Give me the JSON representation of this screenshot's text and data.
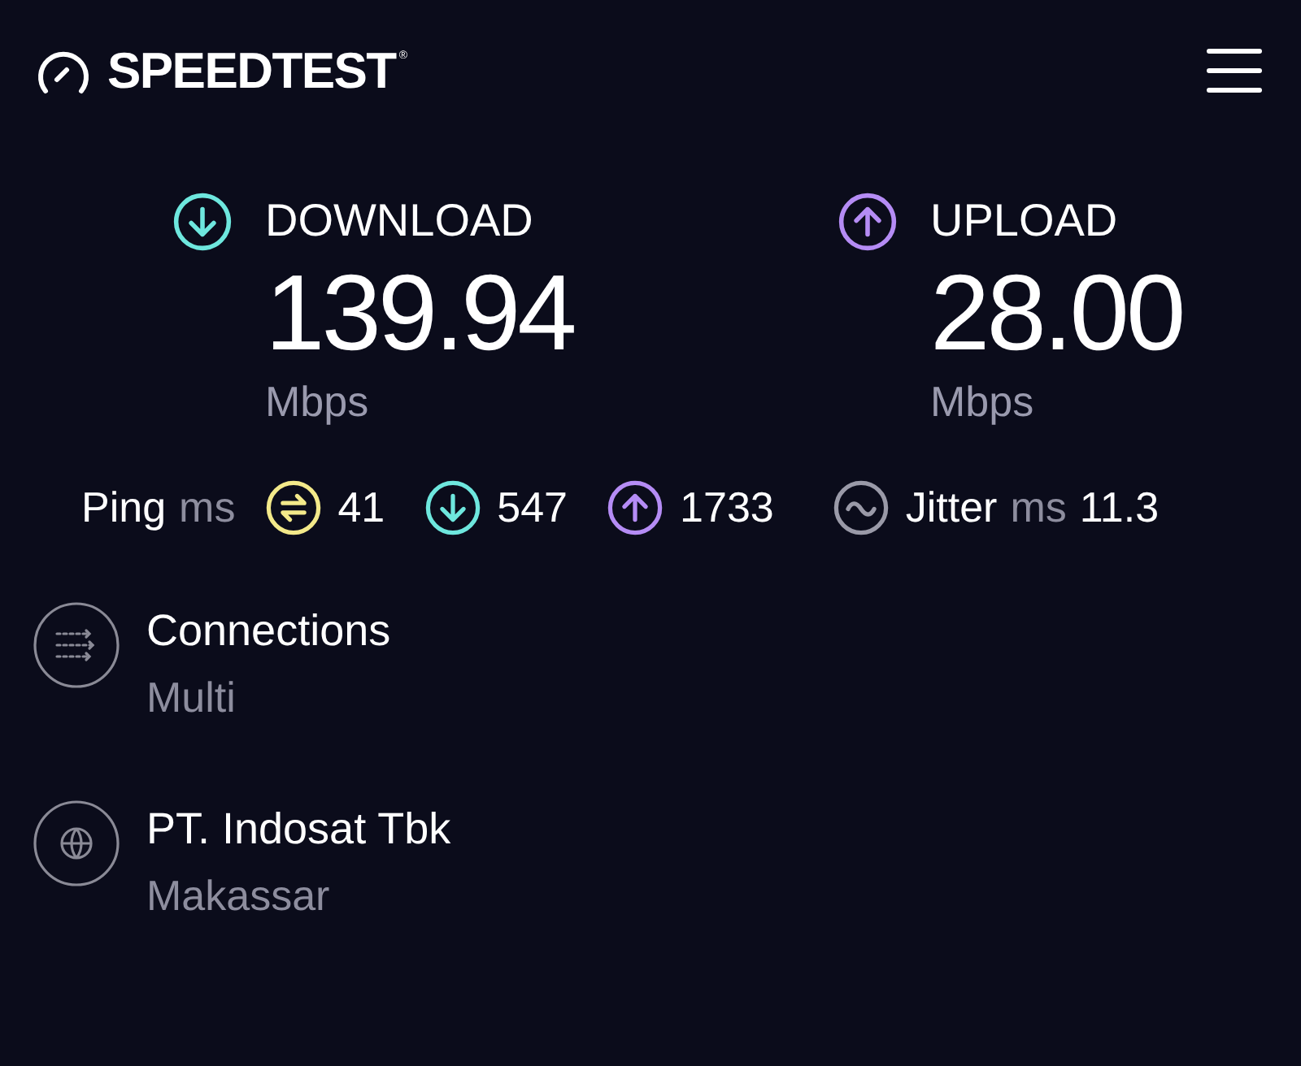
{
  "header": {
    "logo": "SPEEDTEST",
    "logo_mark": "®"
  },
  "results": [
    {
      "kind": "download",
      "label": "DOWNLOAD",
      "value": "139.94",
      "unit": "Mbps"
    },
    {
      "kind": "upload",
      "label": "UPLOAD",
      "value": "28.00",
      "unit": "Mbps"
    }
  ],
  "ping": {
    "label": "Ping",
    "unit": "ms",
    "readings": [
      {
        "kind": "idle",
        "value": "41"
      },
      {
        "kind": "download",
        "value": "547"
      },
      {
        "kind": "upload",
        "value": "1733"
      }
    ]
  },
  "jitter": {
    "label": "Jitter",
    "unit": "ms",
    "value": "11.3"
  },
  "details": [
    {
      "kind": "connections",
      "title": "Connections",
      "subtitle": "Multi"
    },
    {
      "kind": "server",
      "title": "PT. Indosat Tbk",
      "subtitle": "Makassar"
    }
  ]
}
